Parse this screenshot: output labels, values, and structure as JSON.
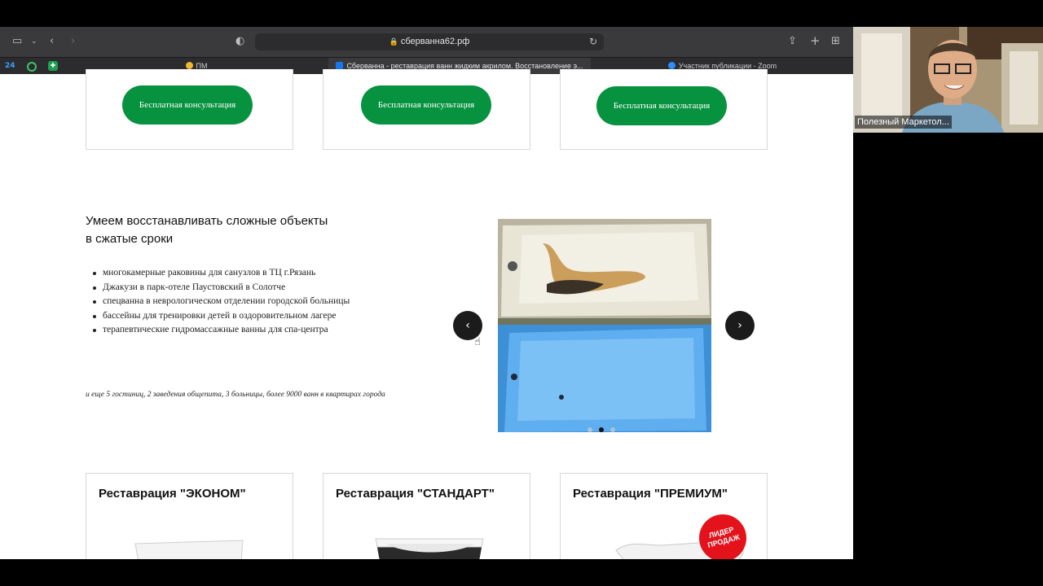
{
  "browser": {
    "url": "сберванна62.рф",
    "tabs": [
      {
        "label": "ПМ"
      },
      {
        "label": "Сберванна - реставрация ванн жидким акрилом. Восстановление э..."
      },
      {
        "label": "Участник публикации - Zoom"
      }
    ],
    "pinned_tabs": [
      {
        "label": "24"
      }
    ]
  },
  "page": {
    "top_buttons": [
      {
        "label": "Бесплатная консультация"
      },
      {
        "label": "Бесплатная консультация"
      },
      {
        "label": "Бесплатная консультация"
      }
    ],
    "section_heading": "Умеем восстанавливать сложные объекты в сжатые сроки",
    "objects_list": [
      "многокамерные раковины для санузлов в ТЦ г.Рязань",
      "Джакузи в парк-отеле Паустовский в Солотче",
      "спецванна в неврологическом отделении городской больницы",
      "бассейны для тренировки детей в оздоровительном лагере",
      "терапевтические гидромассажные ванны для спа-центра"
    ],
    "note": "и еще 5 гостиниц, 2 заведения общепита, 3 больницы, более 9000 ванн в квартирах города",
    "slider": {
      "slides": 3,
      "active_slide": 2
    },
    "packages": [
      {
        "title": "Реставрация \"ЭКОНОМ\""
      },
      {
        "title": "Реставрация \"СТАНДАРТ\""
      },
      {
        "title": "Реставрация \"ПРЕМИУМ\"",
        "badge": "ЛИДЕР ПРОДАЖ"
      }
    ]
  },
  "webcam": {
    "participant_name": "Полезный Маркетол..."
  },
  "colors": {
    "accent_green": "#079240",
    "badge_red": "#e3121b"
  }
}
